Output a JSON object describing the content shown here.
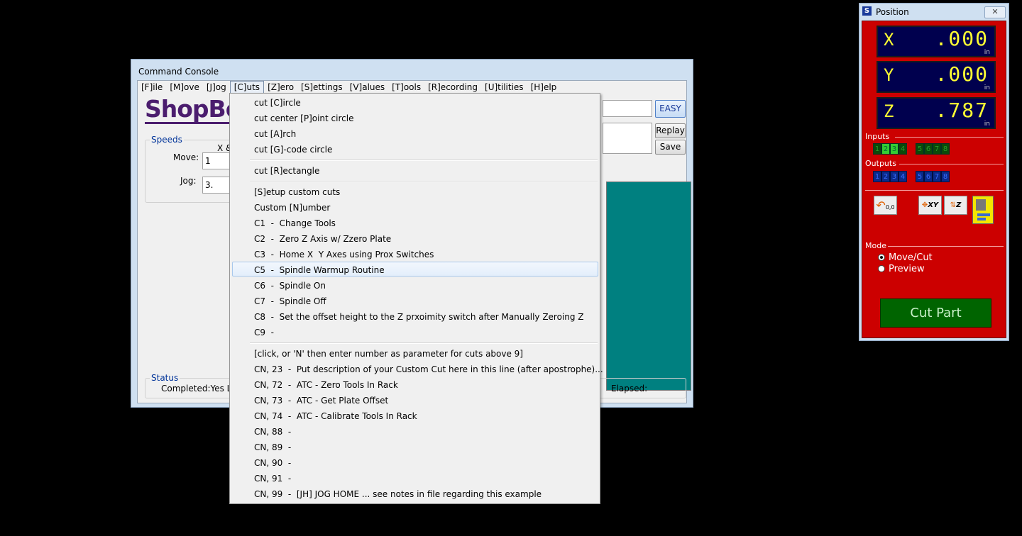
{
  "console": {
    "title": "Command Console",
    "menu": [
      "[F]ile",
      "[M]ove",
      "[J]og",
      "[C]uts",
      "[Z]ero",
      "[S]ettings",
      "[V]alues",
      "[T]ools",
      "[R]ecording",
      "[U]tilities",
      "[H]elp"
    ],
    "active_menu": "[C]uts",
    "logo": "ShopBo",
    "speeds": {
      "legend": "Speeds",
      "col_header": "X &",
      "move_label": "Move:",
      "move_value": "1",
      "jog_label": "Jog:",
      "jog_value": "3."
    },
    "easy_label": "EASY",
    "replay_label": "Replay",
    "save_label": "Save",
    "status": {
      "legend": "Status",
      "completed": "Completed:Yes Ln",
      "elapsed": "Elapsed:"
    }
  },
  "cuts_menu": {
    "highlighted_index": 10,
    "items": [
      "cut [C]ircle",
      "cut center [P]oint circle",
      "cut [A]rch",
      "cut [G]-code circle",
      "cut [R]ectangle",
      "[S]etup custom cuts",
      "Custom [N]umber",
      "C1  -  Change Tools",
      "C2  -  Zero Z Axis w/ Zzero Plate",
      "C3  -  Home X  Y Axes using Prox Switches",
      "C5  -  Spindle Warmup Routine",
      "C6  -  Spindle On",
      "C7  -  Spindle Off",
      "C8  -  Set the offset height to the Z prxoimity switch after Manually Zeroing Z",
      "C9  -",
      "[click, or 'N' then enter number as parameter for cuts above 9]",
      "CN, 23  -  Put description of your Custom Cut here in this line (after apostrophe)...",
      "CN, 72  -  ATC - Zero Tools In Rack",
      "CN, 73  -  ATC - Get Plate Offset",
      "CN, 74  -  ATC - Calibrate Tools In Rack",
      "CN, 88  -",
      "CN, 89  -",
      "CN, 90  -",
      "CN, 91  -",
      "CN, 99  -  [JH] JOG HOME ... see notes in file regarding this example"
    ]
  },
  "position": {
    "title": "Position",
    "axes": [
      {
        "label": "X",
        "value": ".000",
        "unit": "in"
      },
      {
        "label": "Y",
        "value": ".000",
        "unit": "in"
      },
      {
        "label": "Z",
        "value": ".787",
        "unit": "in"
      }
    ],
    "inputs_label": "Inputs",
    "inputs": [
      "1",
      "2",
      "3",
      "4",
      "5",
      "6",
      "7",
      "8"
    ],
    "inputs_on": [
      "2",
      "3"
    ],
    "outputs_label": "Outputs",
    "outputs": [
      "1",
      "2",
      "3",
      "4",
      "5",
      "6",
      "7",
      "8"
    ],
    "zero_button_text": "0,0",
    "xy_button_text": "XY",
    "z_button_text": "Z",
    "mode_label": "Mode",
    "mode_options": [
      "Move/Cut",
      "Preview"
    ],
    "mode_selected": "Move/Cut",
    "cut_part_label": "Cut Part",
    "colors": {
      "panel": "#cc0000",
      "display_bg": "#00004e",
      "display_text": "#ffff33",
      "led_on": "#33cc33",
      "led_off_input": "#0a4a0a",
      "led_output": "#0a2a8a"
    }
  }
}
